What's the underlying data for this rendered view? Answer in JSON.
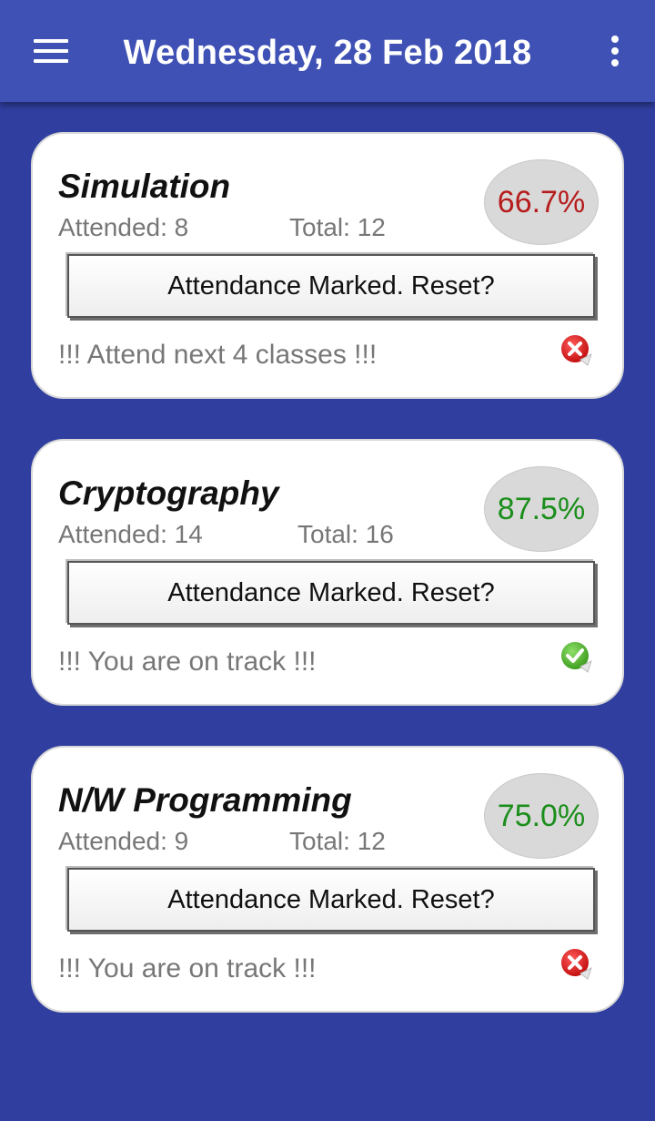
{
  "appbar": {
    "title": "Wednesday, 28 Feb 2018",
    "menu_icon": "hamburger-menu-icon",
    "overflow_icon": "more-vert-icon",
    "color": "#3F51B5"
  },
  "background_color": "#303F9F",
  "subjects": [
    {
      "name": "Simulation",
      "attended": "Attended: 8",
      "total": "Total: 12",
      "percentage": "66.7%",
      "percentage_color": "#B71C1C",
      "button_label": "Attendance Marked. Reset?",
      "status_message": "!!! Attend next 4 classes !!!",
      "status_icon": "cross-icon"
    },
    {
      "name": "Cryptography",
      "attended": "Attended: 14",
      "total": "Total: 16",
      "percentage": "87.5%",
      "percentage_color": "#1B8E1B",
      "button_label": "Attendance Marked. Reset?",
      "status_message": "!!! You are on track !!!",
      "status_icon": "check-icon"
    },
    {
      "name": "N/W Programming",
      "attended": "Attended: 9",
      "total": "Total: 12",
      "percentage": "75.0%",
      "percentage_color": "#1B8E1B",
      "button_label": "Attendance Marked. Reset?",
      "status_message": "!!! You are on track !!!",
      "status_icon": "cross-icon"
    }
  ]
}
